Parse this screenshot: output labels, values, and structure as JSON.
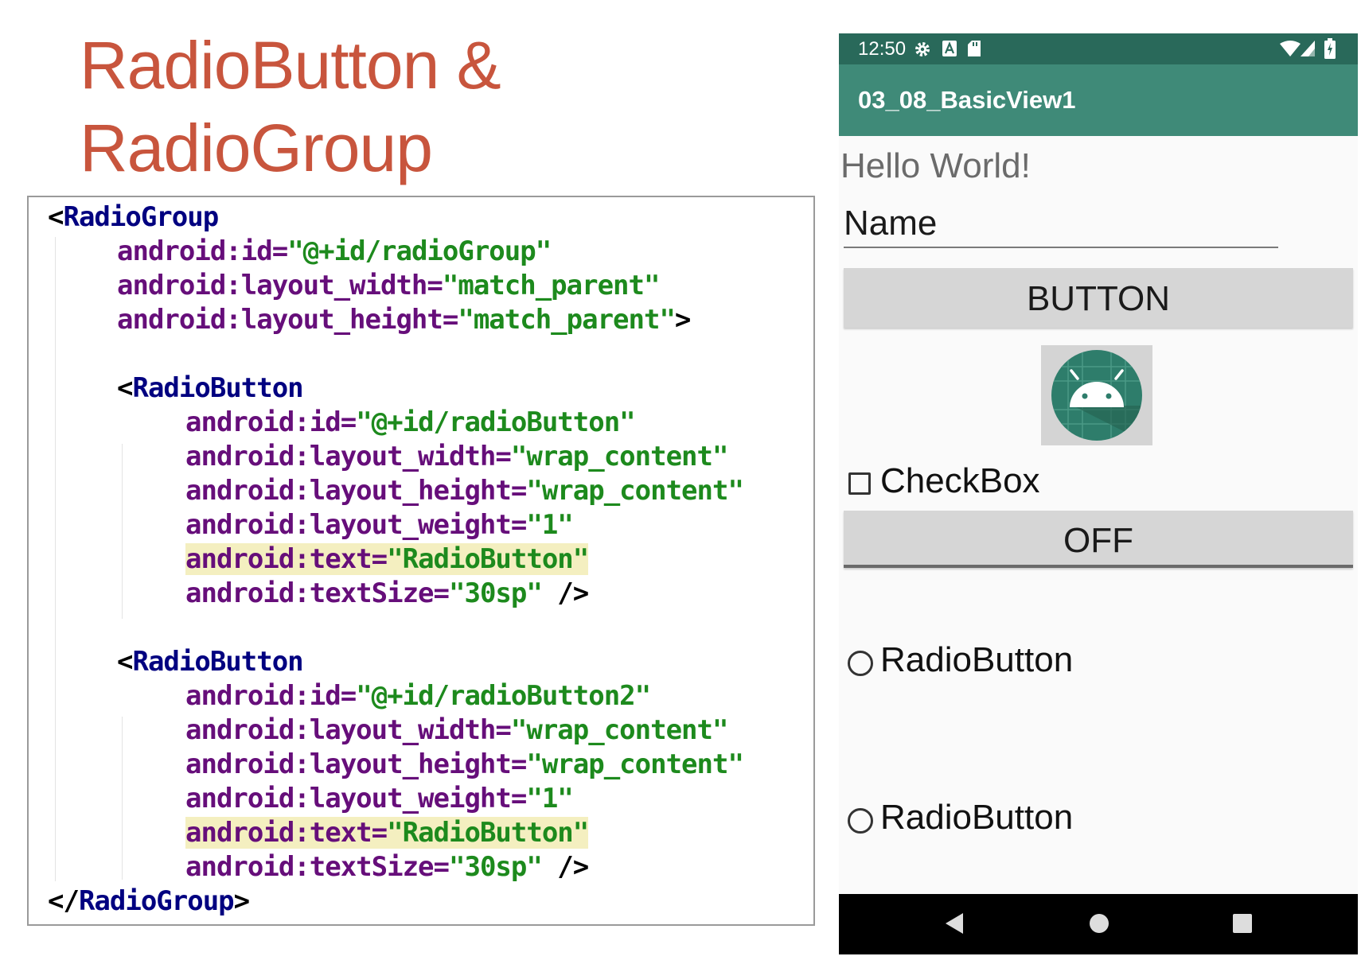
{
  "slide": {
    "title_line1": "RadioButton &",
    "title_line2": "RadioGroup"
  },
  "code": {
    "line01": {
      "open": "<",
      "tag": "RadioGroup"
    },
    "line02": {
      "ns": "android:",
      "attr": "id=",
      "val": "\"@+id/radioGroup\""
    },
    "line03": {
      "ns": "android:",
      "attr": "layout_width=",
      "val": "\"match_parent\""
    },
    "line04": {
      "ns": "android:",
      "attr": "layout_height=",
      "val": "\"match_parent\"",
      "close": ">"
    },
    "line05": {
      "open": "<",
      "tag": "RadioButton"
    },
    "line06": {
      "ns": "android:",
      "attr": "id=",
      "val": "\"@+id/radioButton\""
    },
    "line07": {
      "ns": "android:",
      "attr": "layout_width=",
      "val": "\"wrap_content\""
    },
    "line08": {
      "ns": "android:",
      "attr": "layout_height=",
      "val": "\"wrap_content\""
    },
    "line09": {
      "ns": "android:",
      "attr": "layout_weight=",
      "val": "\"1\""
    },
    "line10": {
      "ns": "android:",
      "attr": "text=",
      "val": "\"RadioButton\""
    },
    "line11": {
      "ns": "android:",
      "attr": "textSize=",
      "val": "\"30sp\"",
      "close": " />"
    },
    "line12": {
      "open": "<",
      "tag": "RadioButton"
    },
    "line13": {
      "ns": "android:",
      "attr": "id=",
      "val": "\"@+id/radioButton2\""
    },
    "line14": {
      "ns": "android:",
      "attr": "layout_width=",
      "val": "\"wrap_content\""
    },
    "line15": {
      "ns": "android:",
      "attr": "layout_height=",
      "val": "\"wrap_content\""
    },
    "line16": {
      "ns": "android:",
      "attr": "layout_weight=",
      "val": "\"1\""
    },
    "line17": {
      "ns": "android:",
      "attr": "text=",
      "val": "\"RadioButton\""
    },
    "line18": {
      "ns": "android:",
      "attr": "textSize=",
      "val": "\"30sp\"",
      "close": " />"
    },
    "line19": {
      "open": "</",
      "tag": "RadioGroup",
      "close": ">"
    }
  },
  "phone": {
    "status_time": "12:50",
    "status_icons": [
      "settings-gear-icon",
      "a-badge-icon",
      "sd-card-icon",
      "wifi-icon",
      "signal-icon",
      "battery-icon"
    ],
    "app_title": "03_08_BasicView1",
    "hello_text": "Hello World!",
    "name_placeholder": "Name",
    "button_label": "BUTTON",
    "image_icon": "android-robot-icon",
    "checkbox": {
      "label": "CheckBox",
      "checked": false
    },
    "toggle_label": "OFF",
    "radio_buttons": [
      {
        "label": "RadioButton",
        "checked": false
      },
      {
        "label": "RadioButton",
        "checked": false
      }
    ],
    "nav_icons": [
      "back-triangle-icon",
      "home-circle-icon",
      "recents-square-icon"
    ]
  },
  "colors": {
    "title": "#c8553d",
    "status_bar": "#29695a",
    "app_bar": "#3f8a78",
    "code_tag": "#000080",
    "code_attr": "#660e7a",
    "code_value": "#1d8a1d",
    "code_highlight": "#f4efc0"
  }
}
